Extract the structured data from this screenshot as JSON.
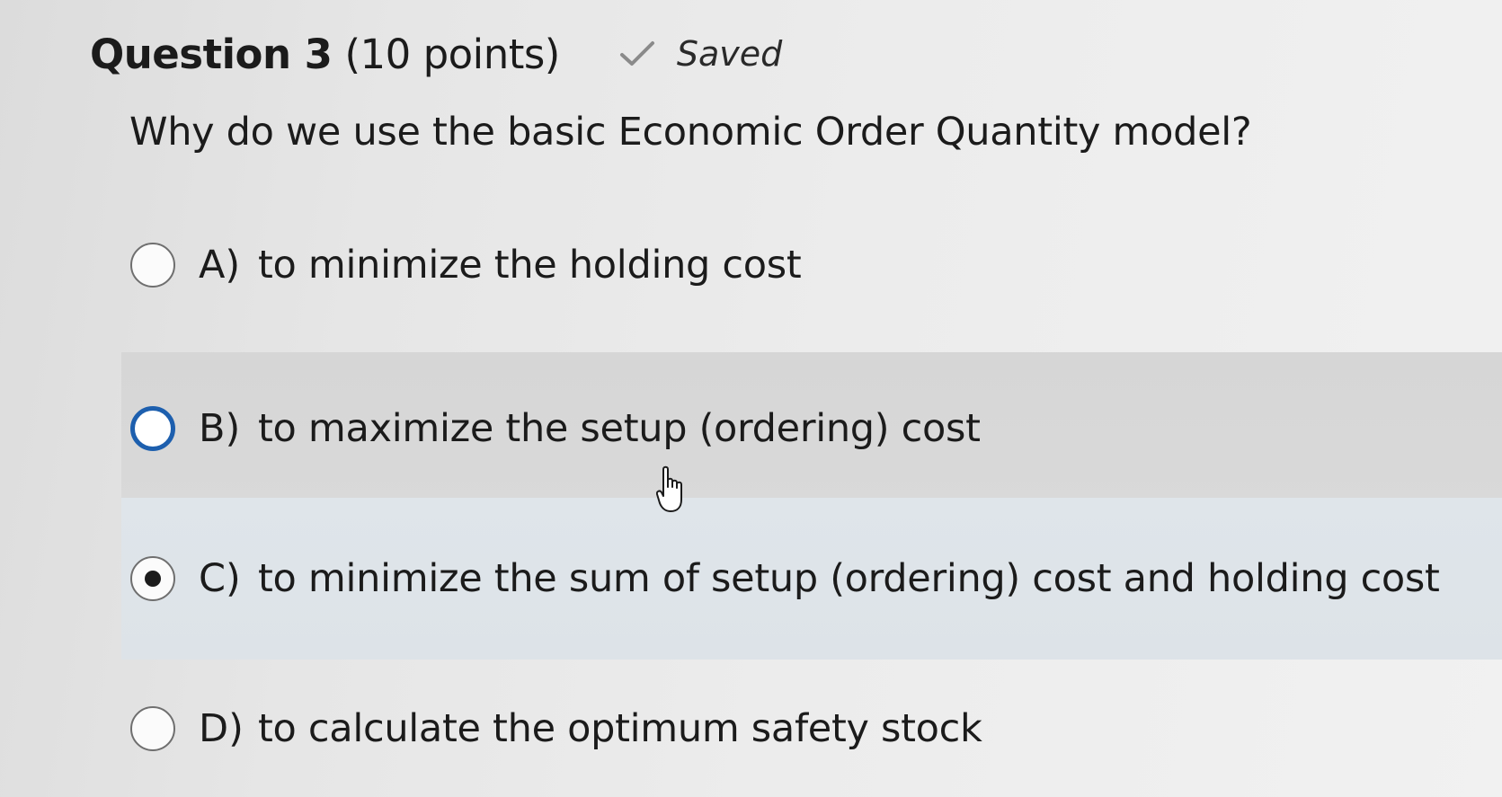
{
  "question": {
    "title": "Question 3",
    "points": "(10 points)",
    "status": "Saved",
    "status_icon": "checkmark-icon",
    "prompt": "Why do we use the basic Economic Order Quantity model?"
  },
  "options": [
    {
      "letter": "A)",
      "text": "to minimize the holding cost",
      "selected": false
    },
    {
      "letter": "B)",
      "text": "to maximize the setup (ordering) cost",
      "selected": false,
      "hovered": true
    },
    {
      "letter": "C)",
      "text": "to minimize the sum of setup (ordering) cost and holding cost",
      "selected": true
    },
    {
      "letter": "D)",
      "text": "to calculate the optimum safety stock",
      "selected": false
    }
  ],
  "colors": {
    "focus_ring": "#1d5fae",
    "hover_row": "#d8d8d8",
    "selected_row": "#dfe5ea"
  },
  "cursor": "hand-pointer-icon"
}
